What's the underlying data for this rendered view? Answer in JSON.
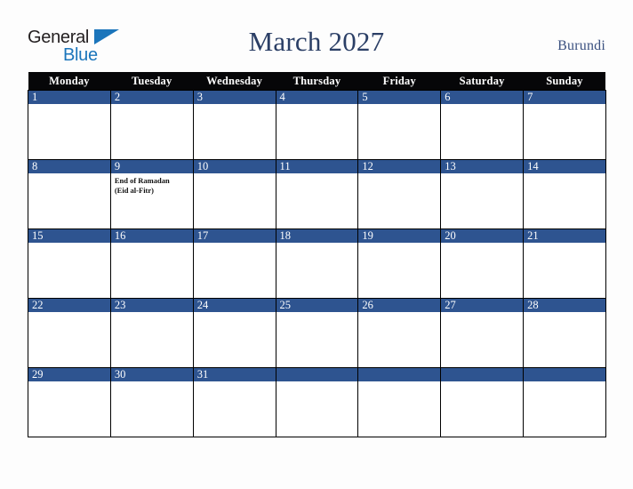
{
  "brand": {
    "line1": "General",
    "line2": "Blue",
    "triangle_color": "#1b75bb",
    "text_color": "#231f20"
  },
  "header": {
    "title": "March 2027",
    "country": "Burundi",
    "title_color": "#2b3f66"
  },
  "calendar": {
    "weekday_headers": [
      "Monday",
      "Tuesday",
      "Wednesday",
      "Thursday",
      "Friday",
      "Saturday",
      "Sunday"
    ],
    "header_bg": "#060608",
    "daynum_bg": "#2e5490",
    "weeks": [
      [
        {
          "day": "1",
          "events": []
        },
        {
          "day": "2",
          "events": []
        },
        {
          "day": "3",
          "events": []
        },
        {
          "day": "4",
          "events": []
        },
        {
          "day": "5",
          "events": []
        },
        {
          "day": "6",
          "events": []
        },
        {
          "day": "7",
          "events": []
        }
      ],
      [
        {
          "day": "8",
          "events": []
        },
        {
          "day": "9",
          "events": [
            "End of Ramadan",
            "(Eid al-Fitr)"
          ]
        },
        {
          "day": "10",
          "events": []
        },
        {
          "day": "11",
          "events": []
        },
        {
          "day": "12",
          "events": []
        },
        {
          "day": "13",
          "events": []
        },
        {
          "day": "14",
          "events": []
        }
      ],
      [
        {
          "day": "15",
          "events": []
        },
        {
          "day": "16",
          "events": []
        },
        {
          "day": "17",
          "events": []
        },
        {
          "day": "18",
          "events": []
        },
        {
          "day": "19",
          "events": []
        },
        {
          "day": "20",
          "events": []
        },
        {
          "day": "21",
          "events": []
        }
      ],
      [
        {
          "day": "22",
          "events": []
        },
        {
          "day": "23",
          "events": []
        },
        {
          "day": "24",
          "events": []
        },
        {
          "day": "25",
          "events": []
        },
        {
          "day": "26",
          "events": []
        },
        {
          "day": "27",
          "events": []
        },
        {
          "day": "28",
          "events": []
        }
      ],
      [
        {
          "day": "29",
          "events": []
        },
        {
          "day": "30",
          "events": []
        },
        {
          "day": "31",
          "events": []
        },
        {
          "day": "",
          "events": []
        },
        {
          "day": "",
          "events": []
        },
        {
          "day": "",
          "events": []
        },
        {
          "day": "",
          "events": []
        }
      ]
    ]
  }
}
